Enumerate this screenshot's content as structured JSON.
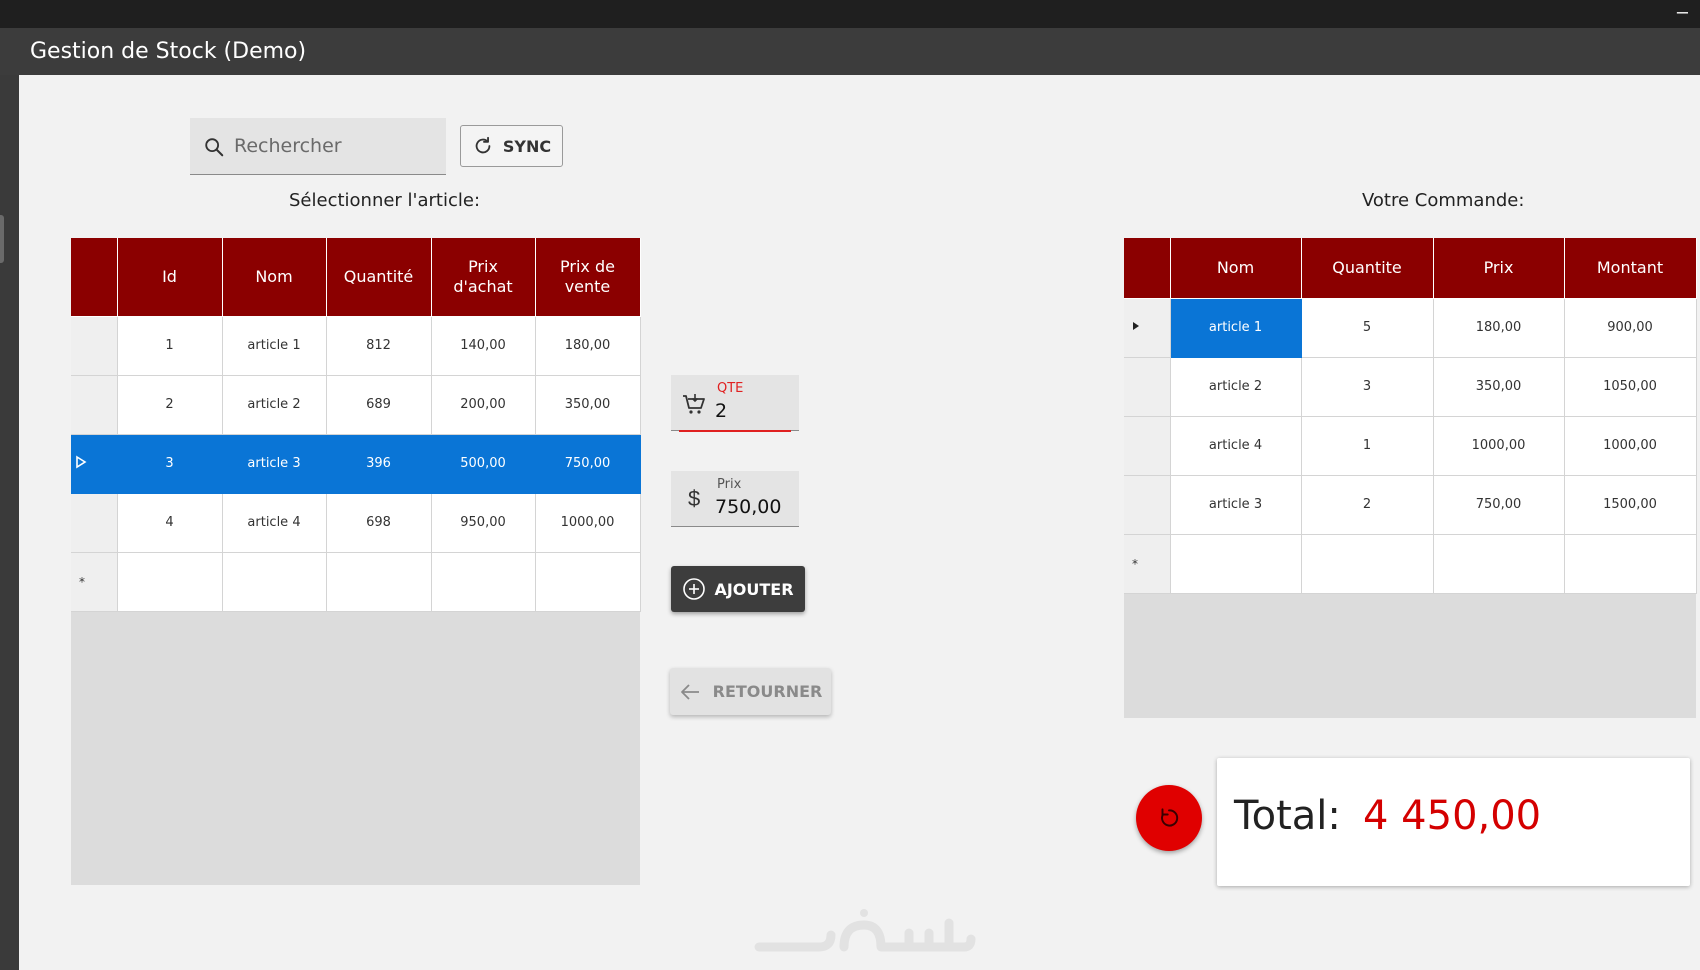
{
  "window": {
    "title": "Gestion de Stock (Demo)",
    "minimize_glyph": "–"
  },
  "search": {
    "placeholder": "Rechercher",
    "value": ""
  },
  "sync": {
    "label": "SYNC"
  },
  "articles": {
    "section_label": "Sélectionner l'article:",
    "columns": [
      "Id",
      "Nom",
      "Quantité",
      "Prix d'achat",
      "Prix de vente"
    ],
    "rows": [
      {
        "id": "1",
        "nom": "article 1",
        "quantite": "812",
        "prix_achat": "140,00",
        "prix_vente": "180,00"
      },
      {
        "id": "2",
        "nom": "article 2",
        "quantite": "689",
        "prix_achat": "200,00",
        "prix_vente": "350,00"
      },
      {
        "id": "3",
        "nom": "article 3",
        "quantite": "396",
        "prix_achat": "500,00",
        "prix_vente": "750,00"
      },
      {
        "id": "4",
        "nom": "article 4",
        "quantite": "698",
        "prix_achat": "950,00",
        "prix_vente": "1000,00"
      }
    ],
    "selected_row": 3,
    "new_row_marker": "*"
  },
  "qte_field": {
    "label": "QTE",
    "value": "2",
    "label_color": "#e02020"
  },
  "prix_field": {
    "label": "Prix",
    "value": "750,00",
    "icon_glyph": "$"
  },
  "ajouter": {
    "label": "AJOUTER"
  },
  "retourner": {
    "label": "RETOURNER"
  },
  "commande": {
    "section_label": "Votre Commande:",
    "columns": [
      "Nom",
      "Quantite",
      "Prix",
      "Montant"
    ],
    "rows": [
      {
        "nom": "article 1",
        "quantite": "5",
        "prix": "180,00",
        "montant": "900,00"
      },
      {
        "nom": "article 2",
        "quantite": "3",
        "prix": "350,00",
        "montant": "1050,00"
      },
      {
        "nom": "article 4",
        "quantite": "1",
        "prix": "1000,00",
        "montant": "1000,00"
      },
      {
        "nom": "article 3",
        "quantite": "2",
        "prix": "750,00",
        "montant": "1500,00"
      }
    ],
    "current_row": 1,
    "new_row_marker": "*"
  },
  "total": {
    "label": "Total:",
    "value": "4 450,00"
  },
  "colors": {
    "header_red": "#8b0000",
    "selection_blue": "#0a75d6",
    "total_red": "#d40000",
    "accent_red": "#e00000"
  },
  "icons": {
    "search": "search-icon",
    "sync": "refresh-icon",
    "cart": "cart-icon",
    "dollar": "dollar-icon",
    "add": "plus-circle-icon",
    "back": "arrow-left-icon",
    "reset": "refresh-icon",
    "row_selected": "triangle-right-outline-icon",
    "row_current": "triangle-right-filled-icon"
  }
}
